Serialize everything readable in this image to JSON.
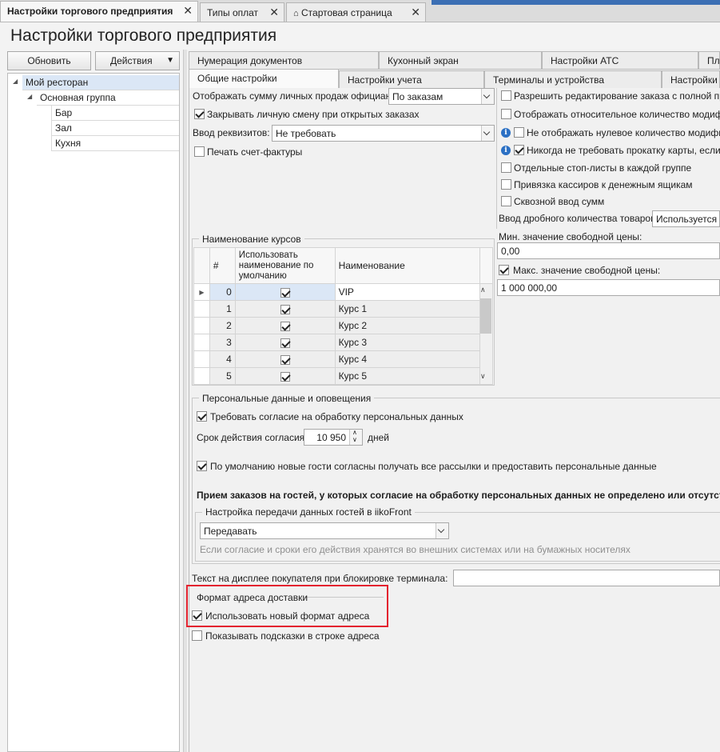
{
  "doc_tabs": [
    {
      "label": "Настройки торгового предприятия",
      "active": true
    },
    {
      "label": "Типы оплат",
      "active": false
    },
    {
      "label": "Стартовая страница",
      "active": false
    }
  ],
  "page_title": "Настройки торгового предприятия",
  "toolbar": {
    "refresh": "Обновить",
    "actions": "Действия"
  },
  "tree": {
    "root": "Мой ресторан",
    "group": "Основная группа",
    "children": [
      "Бар",
      "Зал",
      "Кухня"
    ]
  },
  "settings_tabs_row1": [
    "Нумерация документов",
    "Кухонный экран",
    "Настройки АТС",
    "Пла"
  ],
  "settings_tabs_row2": [
    "Общие настройки",
    "Настройки учета",
    "Терминалы и устройства",
    "Настройки в"
  ],
  "left_col": {
    "show_sales_label": "Отображать сумму личных продаж официанта:",
    "show_sales_value": "По заказам",
    "close_shift_label": "Закрывать личную смену при открытых заказах",
    "requisites_label": "Ввод реквизитов:",
    "requisites_value": "Не требовать",
    "print_invoice_label": "Печать счет-фактуры"
  },
  "right_col": {
    "allow_edit": "Разрешить редактирование заказа с полной предо",
    "show_relative": "Отображать относительное количество модифика",
    "hide_zero": "Не отображать нулевое количество модификат",
    "never_card": "Никогда не требовать прокатку карты, если у",
    "separate_stop": "Отдельные стоп-листы в каждой группе",
    "bind_cashiers": "Привязка кассиров к денежным ящикам",
    "through_sums": "Сквозной ввод сумм",
    "fraction_label": "Ввод дробного количества товаров:",
    "fraction_value": "Используется",
    "min_price_label": "Мин. значение свободной цены:",
    "min_price_value": "0,00",
    "max_price_label": "Макс. значение свободной цены:",
    "max_price_value": "1 000 000,00"
  },
  "courses": {
    "title": "Наименование курсов",
    "headers": {
      "num": "#",
      "use_default": "Использовать наименование по умолчанию",
      "name": "Наименование"
    },
    "rows": [
      {
        "num": "0",
        "name": "VIP"
      },
      {
        "num": "1",
        "name": "Курс 1"
      },
      {
        "num": "2",
        "name": "Курс 2"
      },
      {
        "num": "3",
        "name": "Курс 3"
      },
      {
        "num": "4",
        "name": "Курс 4"
      },
      {
        "num": "5",
        "name": "Курс 5"
      }
    ]
  },
  "personal": {
    "title": "Персональные данные и оповещения",
    "require_consent": "Требовать согласие на обработку персональных данных",
    "term_label": "Срок действия согласия:",
    "term_value": "10 950",
    "term_unit": "дней",
    "default_consent": "По умолчанию новые гости согласны получать все рассылки и предоставить персональные данные",
    "bold_note": "Прием заказов на гостей, у которых согласие на обработку персональных данных не определено или отсутст",
    "transfer_title": "Настройка передачи данных гостей в iikoFront",
    "transfer_value": "Передавать",
    "transfer_hint": "Если согласие и сроки его действия хранятся во внешних системах или на бумажных носителях"
  },
  "display_text_label": "Текст на дисплее покупателя при блокировке терминала:",
  "delivery": {
    "title": "Формат адреса доставки",
    "use_new": "Использовать новый формат адреса",
    "show_hints": "Показывать подсказки в строке адреса"
  }
}
